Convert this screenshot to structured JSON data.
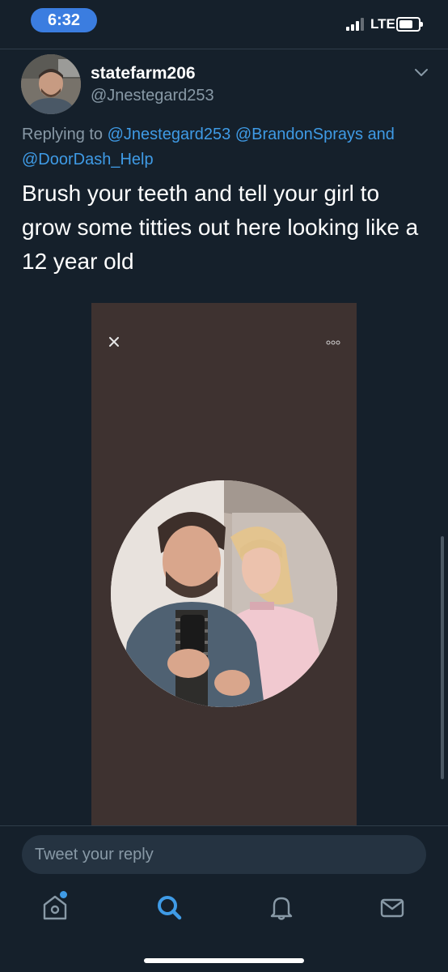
{
  "status_bar": {
    "time": "6:32",
    "network": "LTE"
  },
  "tweet": {
    "display_name": "statefarm206",
    "handle": "@Jnestegard253",
    "replying_to_prefix": "Replying to",
    "mentions": [
      "@Jnestegard253",
      "@BrandonSprays",
      "@DoorDash_Help"
    ],
    "mention_joiner": "and",
    "text": "Brush your teeth and tell your girl to grow some titties out here looking like a 12 year old"
  },
  "reply_bar": {
    "placeholder": "Tweet your reply"
  },
  "tab_bar": {
    "items": [
      "home-icon",
      "search-icon",
      "notifications-icon",
      "messages-icon"
    ],
    "active": "search-icon"
  },
  "colors": {
    "background": "#15202b",
    "accent": "#3f9be6",
    "secondary_text": "#8899a6",
    "media_background": "#3e3230"
  }
}
